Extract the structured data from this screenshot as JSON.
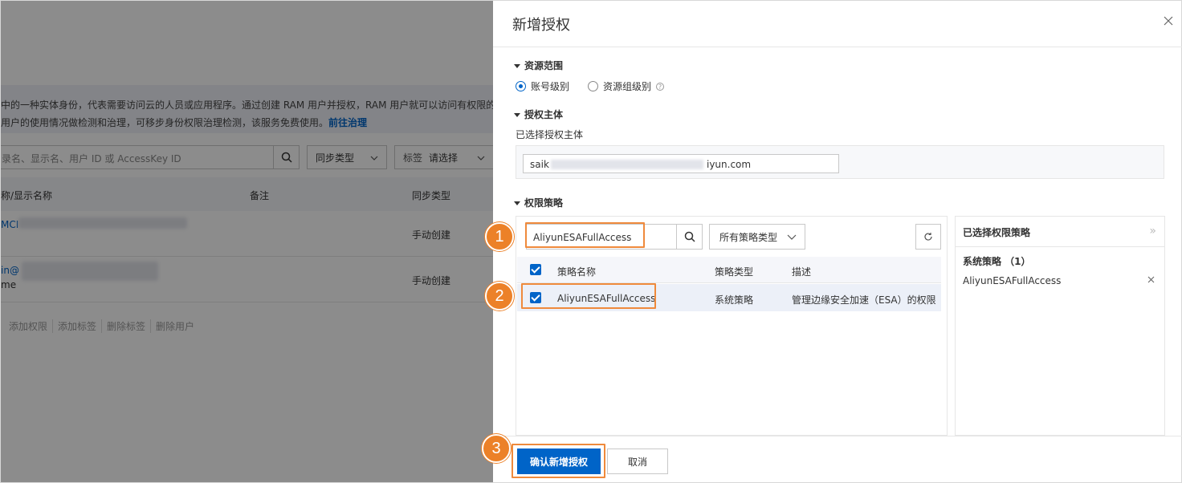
{
  "background": {
    "banner_line1": "中的一种实体身份，代表需要访问云的人员或应用程序。通过创建 RAM 用户并授权，RAM 用户就可以访问有权限的",
    "banner_line2": "用户的使用情况做检测和治理，可移步身份权限治理检测，该服务免费使用。",
    "banner_link": "前往治理",
    "search_placeholder": "录名、显示名、用户 ID 或 AccessKey ID",
    "sync_type_select": "同步类型",
    "tag_label": "标签",
    "tag_placeholder": "请选择",
    "columns": [
      "称/显示名称",
      "备注",
      "同步类型"
    ],
    "rows": [
      {
        "name": "MCI",
        "sub": "",
        "sync": "手动创建"
      },
      {
        "name": "in@",
        "sub": "me",
        "sync": "手动创建"
      }
    ],
    "actions": [
      "添加权限",
      "添加标签",
      "删除标签",
      "删除用户"
    ]
  },
  "drawer": {
    "title": "新增授权",
    "close_icon": "close-icon",
    "resource_scope": {
      "title": "资源范围",
      "options": [
        {
          "label": "账号级别",
          "checked": true
        },
        {
          "label": "资源组级别",
          "checked": false
        }
      ]
    },
    "principal": {
      "title": "授权主体",
      "subtitle": "已选择授权主体",
      "value_prefix": "saik",
      "value_suffix": "iyun.com"
    },
    "policy": {
      "title": "权限策略",
      "search_value": "AliyunESAFullAccess",
      "type_select": "所有策略类型",
      "columns": [
        "策略名称",
        "策略类型",
        "描述"
      ],
      "rows": [
        {
          "name": "AliyunESAFullAccess",
          "type": "系统策略",
          "desc": "管理边缘安全加速（ESA）的权限",
          "checked": true
        }
      ]
    },
    "selected": {
      "title": "已选择权限策略",
      "collapse_icon": "double-chevron-right-icon",
      "group_label": "系统策略 （1）",
      "items": [
        "AliyunESAFullAccess"
      ]
    },
    "footer": {
      "confirm_label": "确认新增授权",
      "cancel_label": "取消"
    }
  },
  "steps": [
    "1",
    "2",
    "3"
  ],
  "colors": {
    "primary": "#0064c8",
    "highlight": "#ef8a3c",
    "step_badge": "#ec8128"
  }
}
